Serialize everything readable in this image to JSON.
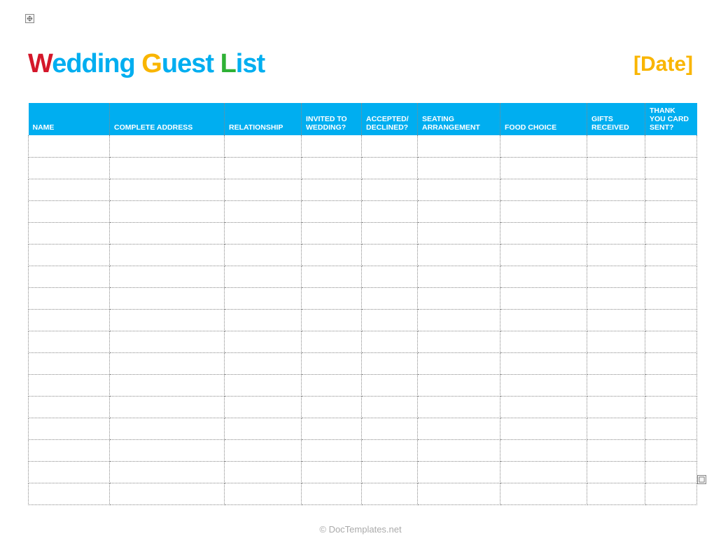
{
  "title": {
    "word1_cap": "W",
    "word1_rest": "edding ",
    "word2_cap": "G",
    "word2_rest": "uest ",
    "word3_cap": "L",
    "word3_rest": "ist"
  },
  "date_placeholder": "[Date]",
  "columns": [
    "NAME",
    "COMPLETE ADDRESS",
    "RELATIONSHIP",
    "INVITED TO WEDDING?",
    "ACCEPTED/ DECLINED?",
    "SEATING ARRANGEMENT",
    "FOOD CHOICE",
    "GIFTS RECEIVED",
    "THANK YOU CARD SENT?"
  ],
  "row_count": 17,
  "footer": "© DocTemplates.net"
}
